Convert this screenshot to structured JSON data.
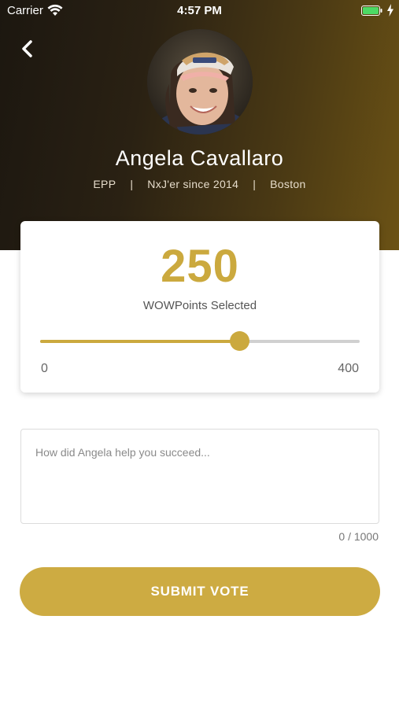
{
  "status_bar": {
    "carrier": "Carrier",
    "time": "4:57 PM",
    "battery_color": "#4cd964"
  },
  "header": {
    "back_icon": "chevron-left-icon",
    "name": "Angela Cavallaro",
    "meta": [
      "EPP",
      "NxJ'er since 2014",
      "Boston"
    ],
    "separator": "|"
  },
  "points": {
    "value": "250",
    "label": "WOWPoints Selected",
    "min_label": "0",
    "max_label": "400",
    "min": 0,
    "max": 400,
    "current": 250,
    "accent_color": "#cba93e"
  },
  "message": {
    "placeholder": "How did Angela help you succeed...",
    "value": "",
    "char_count": "0 / 1000"
  },
  "submit": {
    "label": "SUBMIT VOTE",
    "color": "#cdab42"
  }
}
